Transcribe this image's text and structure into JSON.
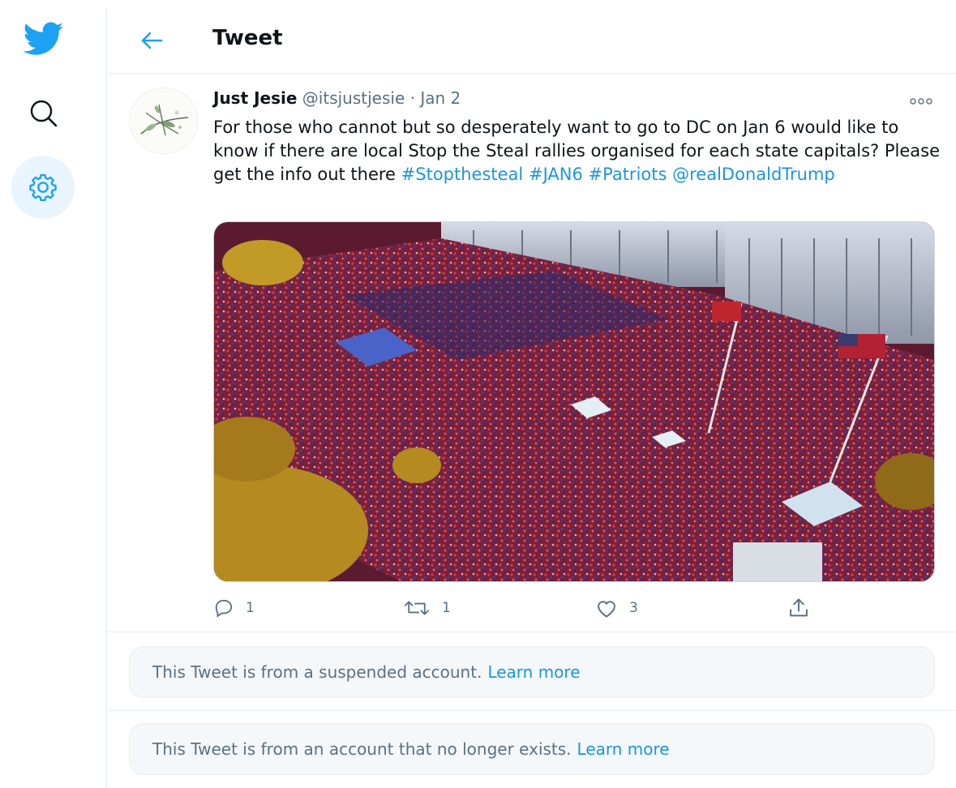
{
  "nav": {
    "logo_icon": "twitter-bird-icon",
    "search_icon": "search-icon",
    "settings_icon": "gear-icon",
    "accent": "#1da1f2"
  },
  "header": {
    "title": "Tweet",
    "back_icon": "arrow-left-icon"
  },
  "tweet": {
    "author_name": "Just Jesie",
    "author_handle": "@itsjustjesie",
    "separator": "·",
    "date": "Jan 2",
    "text_plain": "For those who cannot but so desperately want to go to DC on Jan 6 would like to know if there are local Stop the Steal rallies organised for each state capitals? Please get the info out there",
    "hashtags": [
      "#Stopthesteal",
      "#JAN6",
      "#Patriots"
    ],
    "mention": "@realDonaldTrump",
    "media_description": "Aerial photo of a large crowd with flags in front of buildings",
    "actions": {
      "reply_count": "1",
      "retweet_count": "1",
      "like_count": "3"
    }
  },
  "notices": [
    {
      "text": "This Tweet is from a suspended account.",
      "link": "Learn more"
    },
    {
      "text": "This Tweet is from an account that no longer exists.",
      "link": "Learn more"
    }
  ]
}
